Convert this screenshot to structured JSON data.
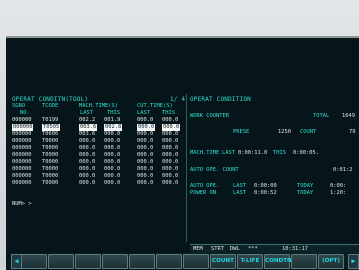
{
  "left_panel": {
    "title": "OPERAT CONDITN(TOOL)",
    "page": "1/ 4",
    "headers": {
      "sgno": "SGNO",
      "tcode": "TCODE",
      "mach_time": "MACH.TIME(S)",
      "cut_time": "CUT.TIME(S)",
      "no": "NO.",
      "last1": "LAST",
      "this1": "THIS",
      "last2": "LAST",
      "this2": "THIS"
    },
    "rows": [
      {
        "sgno": "000000",
        "tcode": "T0199",
        "mach_last": "002.2",
        "mach_this": "001.9",
        "cut_last": "000.0",
        "cut_this": "000.0"
      },
      {
        "sgno": "000000",
        "tcode": "T0505",
        "mach_last": "003.6",
        "mach_this": "002.8",
        "cut_last": "000.0",
        "cut_this": "000.0"
      },
      {
        "sgno": "000000",
        "tcode": "T0606",
        "mach_last": "003.6",
        "mach_this": "000.0",
        "cut_last": "000.0",
        "cut_this": "000.0"
      },
      {
        "sgno": "000000",
        "tcode": "T0000",
        "mach_last": "000.0",
        "mach_this": "000.0",
        "cut_last": "000.0",
        "cut_this": "000.0"
      },
      {
        "sgno": "000000",
        "tcode": "T0000",
        "mach_last": "000.0",
        "mach_this": "000.0",
        "cut_last": "000.0",
        "cut_this": "000.0"
      },
      {
        "sgno": "000000",
        "tcode": "T0000",
        "mach_last": "000.0",
        "mach_this": "000.0",
        "cut_last": "000.0",
        "cut_this": "000.0"
      },
      {
        "sgno": "000000",
        "tcode": "T0000",
        "mach_last": "000.0",
        "mach_this": "000.0",
        "cut_last": "000.0",
        "cut_this": "000.0"
      },
      {
        "sgno": "000000",
        "tcode": "T0000",
        "mach_last": "000.0",
        "mach_this": "000.0",
        "cut_last": "000.0",
        "cut_this": "000.0"
      },
      {
        "sgno": "000000",
        "tcode": "T0000",
        "mach_last": "000.0",
        "mach_this": "000.0",
        "cut_last": "000.0",
        "cut_this": "000.0"
      },
      {
        "sgno": "000000",
        "tcode": "T0000",
        "mach_last": "000.0",
        "mach_this": "000.0",
        "cut_last": "000.0",
        "cut_this": "000.0"
      }
    ],
    "prompt": "NUM> >"
  },
  "right_panel": {
    "title": "OPERAT CONDITION",
    "work_counter": "WORK COUNTER",
    "total_label": "TOTAL",
    "total_value": "1649",
    "preset_label": "PRESE",
    "preset_value": "1250",
    "count_label": "COUNT",
    "count_value": "79",
    "mach_time_label": "MACH.TIME",
    "last_label": "LAST",
    "mach_last": "0:00:11.0",
    "this_label": "THIS",
    "mach_this": "0:00:05.",
    "auto_ope_count_label": "AUTO OPE. COUNT",
    "auto_ope_count_value": "0:01:2",
    "auto_ope_label": "AUTO OPE.",
    "auto_ope_last": "0:00:00",
    "today_label": "TODAY",
    "auto_ope_today": "0:00:",
    "power_on_label": "POWER ON",
    "power_on_last": "0:00:52",
    "power_on_today": "1:20:"
  },
  "status": {
    "mode": "MEM",
    "state": "STRT",
    "sub": "DWL",
    "stars": "***",
    "time": "10:31:17"
  },
  "softkeys": [
    "",
    "",
    "",
    "",
    "",
    "",
    "",
    "COUNT",
    "T-LIFE",
    "CONDTN",
    "",
    "(OPT)"
  ],
  "colors": {
    "accent": "#2ee0d2",
    "screen_bg": "#061519",
    "softkey_text": "#1fd6e2"
  }
}
